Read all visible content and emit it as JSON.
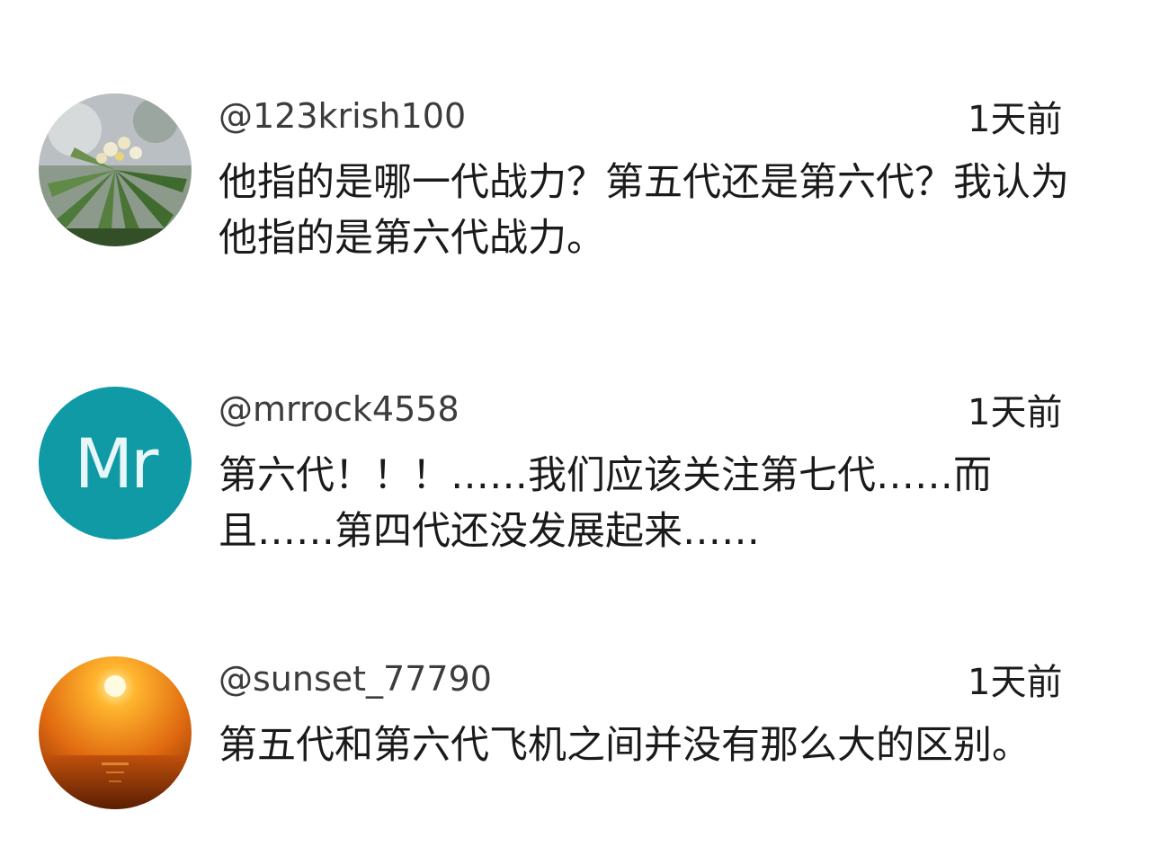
{
  "comments": [
    {
      "username": "@123krish100",
      "time": "1天前",
      "text": "他指的是哪一代战力？第五代还是第六代？我认为他指的是第六代战力。",
      "avatar_icon": "plant-photo"
    },
    {
      "username": "@mrrock4558",
      "time": "1天前",
      "text": "第六代！！！……我们应该关注第七代……而且……第四代还没发展起来……",
      "avatar_initials": "Mr",
      "avatar_color": "#0f9aa6"
    },
    {
      "username": "@sunset_77790",
      "time": "1天前",
      "text": "第五代和第六代飞机之间并没有那么大的区别。",
      "avatar_icon": "sunset-photo"
    }
  ]
}
